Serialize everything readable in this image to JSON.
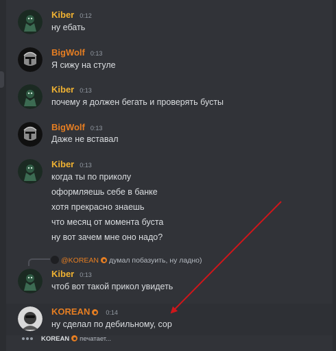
{
  "messages": [
    {
      "author": "Kiber",
      "time": "0:12",
      "lines": [
        "ну ебать"
      ]
    },
    {
      "author": "BigWolf",
      "time": "0:13",
      "lines": [
        "Я сижу на стуле"
      ]
    },
    {
      "author": "Kiber",
      "time": "0:13",
      "lines": [
        "почему я должен бегать и проверять бусты"
      ]
    },
    {
      "author": "BigWolf",
      "time": "0:13",
      "lines": [
        "Даже не вставал"
      ]
    },
    {
      "author": "Kiber",
      "time": "0:13",
      "lines": [
        "когда ты по приколу",
        "оформляешь себе в банке",
        "хотя прекрасно знаешь",
        "что месяц от момента буста",
        "ну вот зачем мне оно надо?"
      ]
    },
    {
      "author": "Kiber",
      "time": "0:13",
      "lines": [
        "чтоб вот такой прикол увидеть"
      ],
      "reply": {
        "mention": "@KOREAN",
        "text": "думал побазуить, ну ладно)"
      }
    },
    {
      "author": "KOREAN",
      "time": "0:14",
      "lines": [
        "ну сделал по дебильному, сор"
      ]
    }
  ],
  "typing": {
    "user": "KOREAN",
    "verb": "печатает..."
  },
  "colors": {
    "background": "#313338",
    "kiber": "#f0b232",
    "bigwolf": "#e67e22",
    "korean": "#e67e22",
    "arrow": "#d0161a"
  }
}
